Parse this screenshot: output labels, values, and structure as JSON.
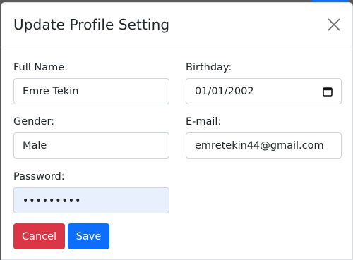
{
  "modal": {
    "title": "Update Profile Setting",
    "close_icon": "close-icon"
  },
  "form": {
    "full_name": {
      "label": "Full Name:",
      "value": "Emre Tekin"
    },
    "birthday": {
      "label": "Birthday:",
      "value": "01/01/2002",
      "icon": "calendar-icon"
    },
    "gender": {
      "label": "Gender:",
      "value": "Male"
    },
    "email": {
      "label": "E-mail:",
      "value": "emretekin44@gmail.com"
    },
    "password": {
      "label": "Password:",
      "value": "•••••••••"
    }
  },
  "buttons": {
    "cancel": "Cancel",
    "save": "Save"
  },
  "colors": {
    "cancel": "#dc3545",
    "save": "#0d6efd",
    "autofill": "#e8f0fe"
  }
}
